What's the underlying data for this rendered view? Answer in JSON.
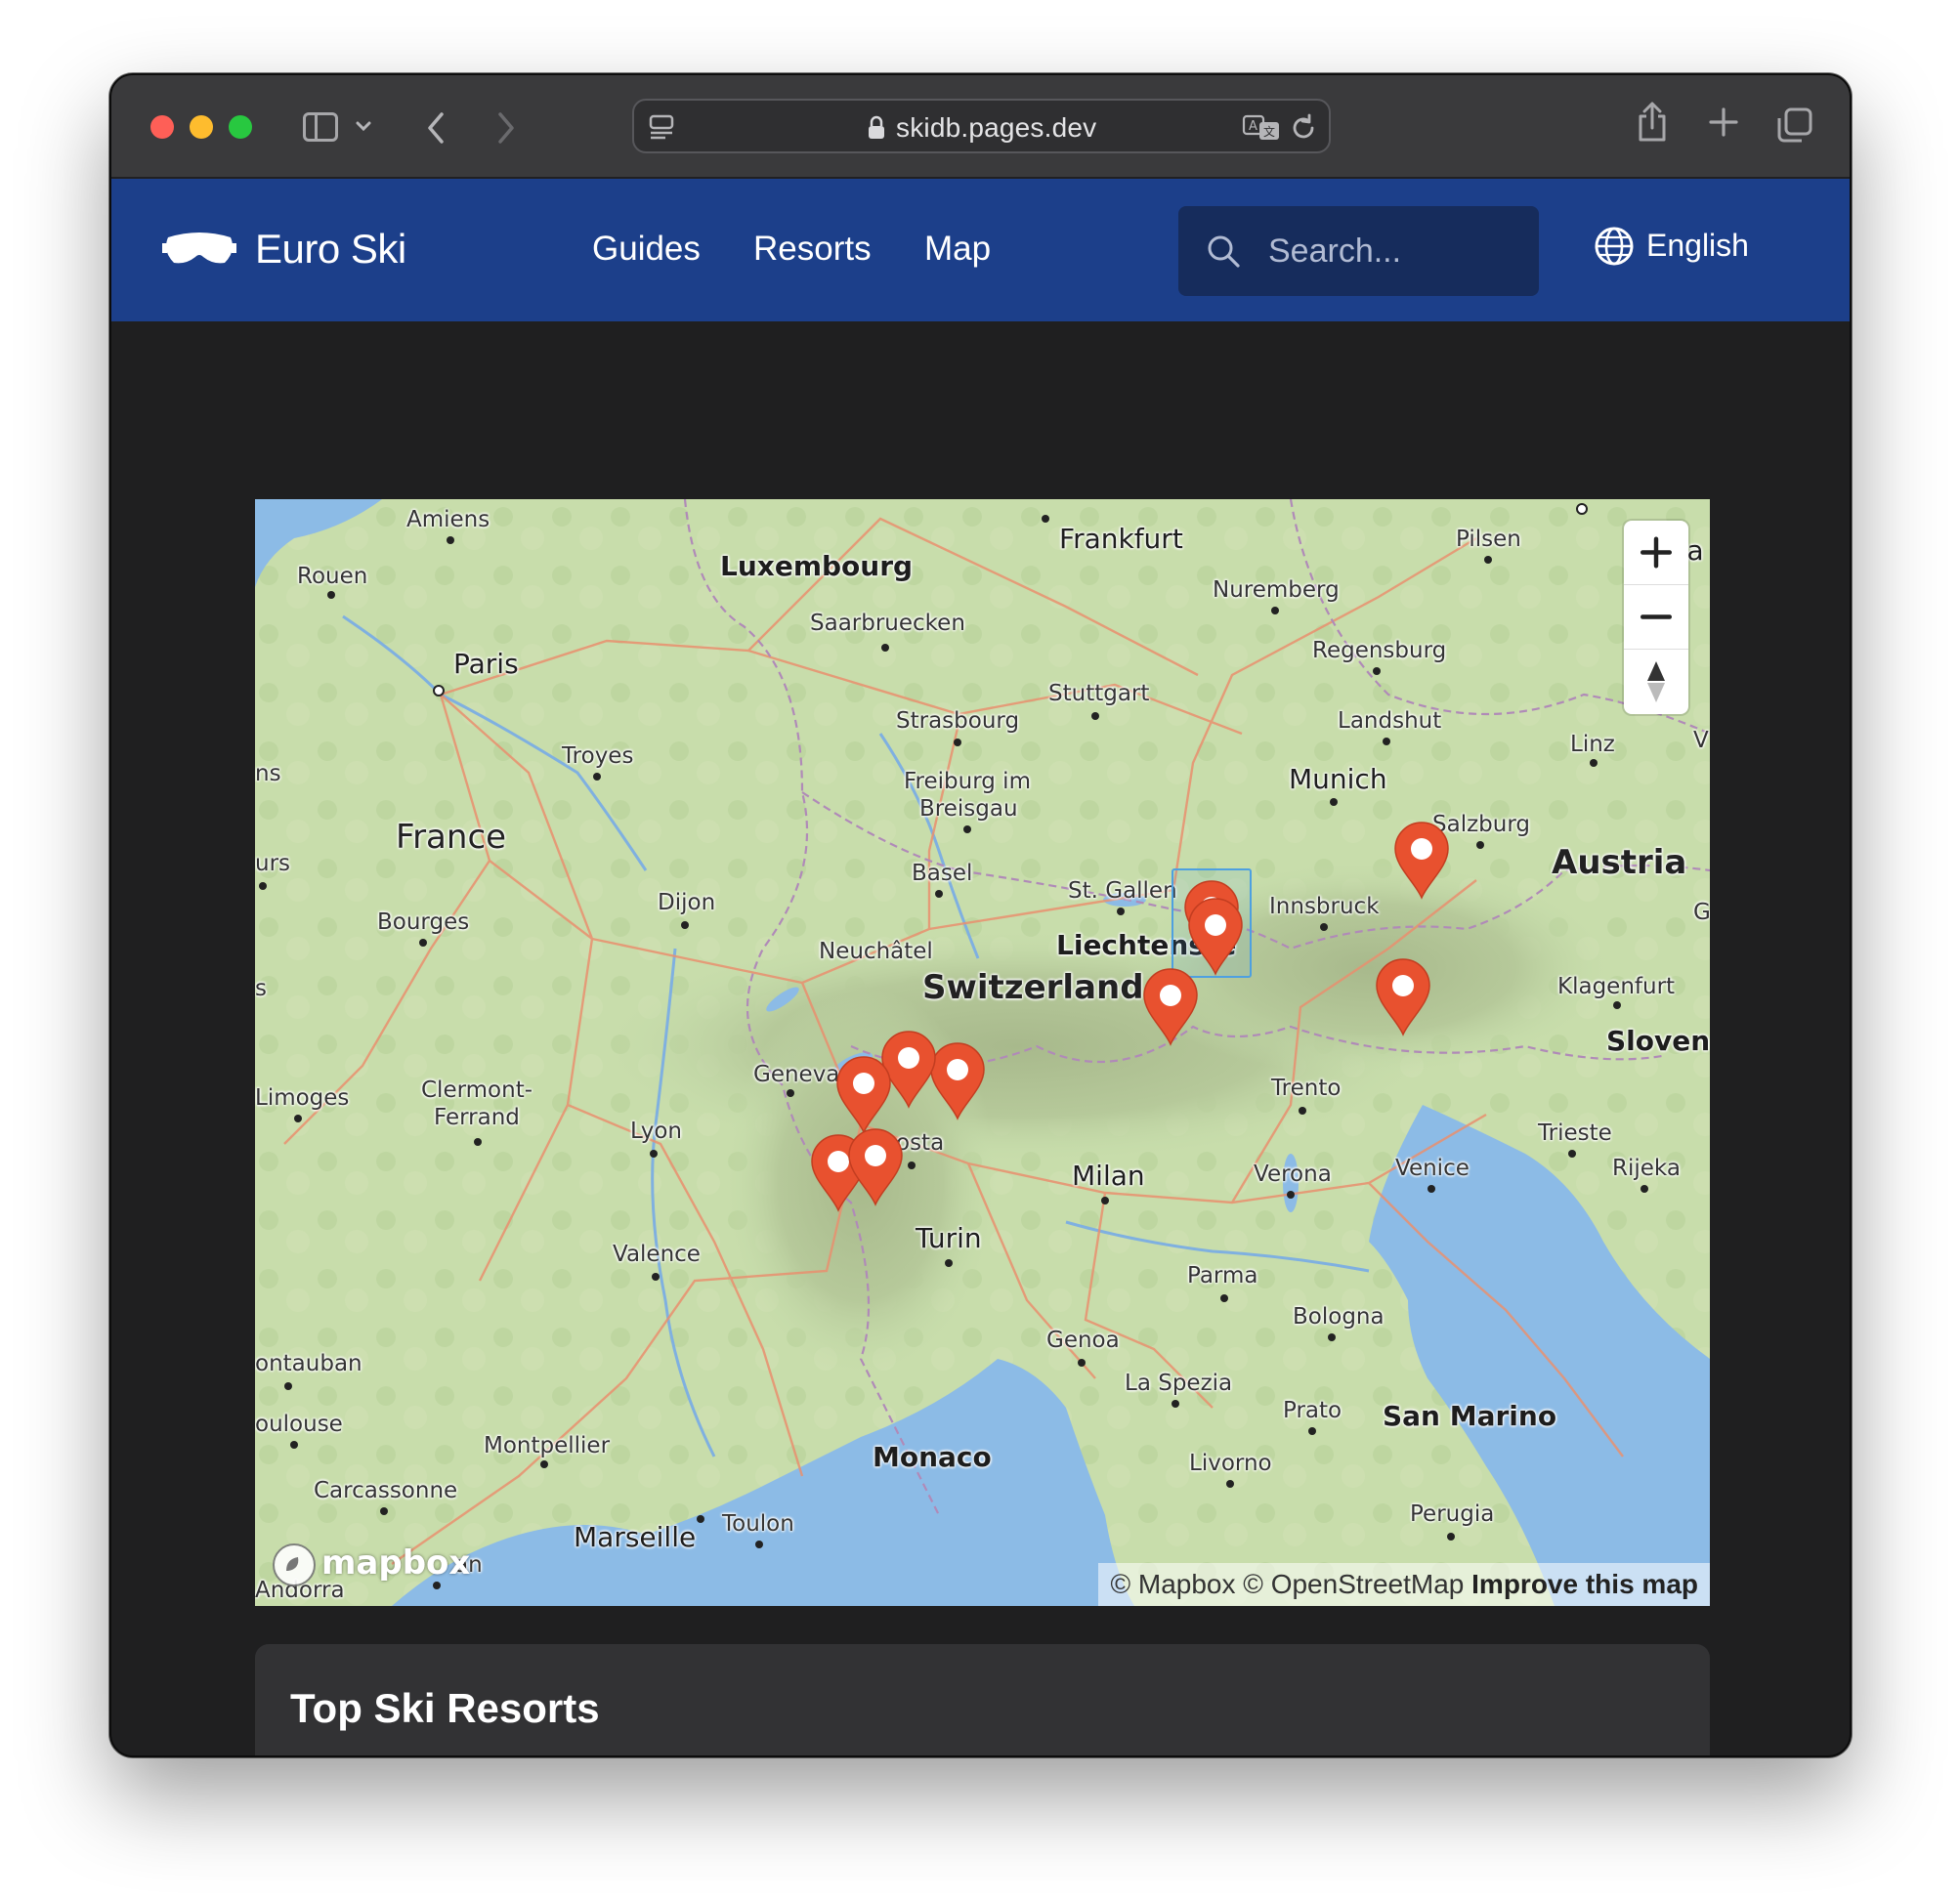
{
  "browser": {
    "url": "skidb.pages.dev"
  },
  "site": {
    "brand": "Euro Ski",
    "nav": [
      "Guides",
      "Resorts",
      "Map"
    ],
    "search_placeholder": "Search...",
    "language": "English",
    "accent_color": "#1c3f8a"
  },
  "map": {
    "labels": {
      "amiens": "Amiens",
      "rouen": "Rouen",
      "paris": "Paris",
      "luxembourg": "Luxembourg",
      "saarbruecken": "Saarbruecken",
      "frankfurt": "Frankfurt",
      "nuremberg": "Nuremberg",
      "pilsen": "Pilsen",
      "regensburg": "Regensburg",
      "stuttgart": "Stuttgart",
      "strasbourg": "Strasbourg",
      "landshut": "Landshut",
      "troyes": "Troyes",
      "freiburg1": "Freiburg im",
      "freiburg2": "Breisgau",
      "munich": "Munich",
      "linz": "Linz",
      "france": "France",
      "salzburg": "Salzburg",
      "austria": "Austria",
      "basel": "Basel",
      "stgallen": "St. Gallen",
      "innsbruck": "Innsbruck",
      "dijon": "Dijon",
      "bourges": "Bourges",
      "neuchatel": "Neuchâtel",
      "liechtenstein": "Liechtenste",
      "switzerland": "Switzerland",
      "klagenfurt": "Klagenfurt",
      "slovenia": "Slovenia",
      "geneva": "Geneva",
      "limoges": "Limoges",
      "clermont1": "Clermont-",
      "clermont2": "Ferrand",
      "trento": "Trento",
      "lyon": "Lyon",
      "aosta": "osta",
      "trieste": "Trieste",
      "milan": "Milan",
      "verona": "Verona",
      "venice": "Venice",
      "rijeka": "Rijeka",
      "turin": "Turin",
      "valence": "Valence",
      "parma": "Parma",
      "bologna": "Bologna",
      "genoa": "Genoa",
      "montauban": "ontauban",
      "laspezia": "La Spezia",
      "toulouse": "oulouse",
      "prato": "Prato",
      "sanmarino": "San Marino",
      "montpellier": "Montpellier",
      "monaco": "Monaco",
      "livorno": "Livorno",
      "carcassonne": "Carcassonne",
      "perugia": "Perugia",
      "marseille": "Marseille",
      "toulon": "Toulon",
      "perpignan": "an",
      "andorra": "Andorra",
      "edge_urs": "urs",
      "edge_ns": "ns",
      "edge_s": "s",
      "edge_g": "G",
      "edge_v": "V",
      "edge_cz": "hia"
    },
    "marker_color": "#e8512f",
    "marker_count": 10,
    "attribution": {
      "mapbox": "© Mapbox",
      "osm": "© OpenStreetMap",
      "improve": "Improve this map"
    },
    "logo_text": "mapbox"
  },
  "section": {
    "title": "Top Ski Resorts"
  }
}
